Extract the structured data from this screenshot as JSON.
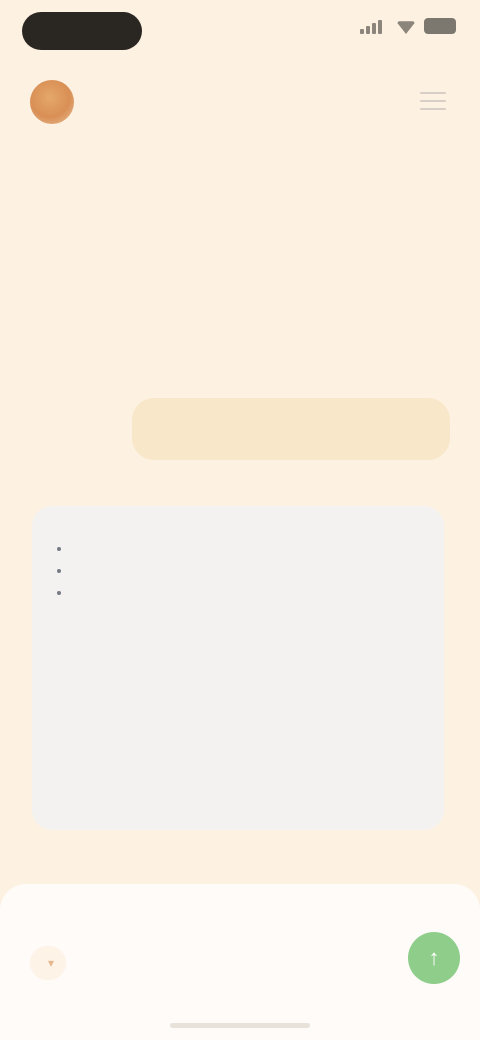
{
  "status_bar": {
    "time": "",
    "pill_color": "#2a2622"
  },
  "header": {
    "name": "",
    "subtitle": ""
  },
  "chat": {
    "user_message": "",
    "assistant_paragraph_1": "",
    "assistant_paragraph_2": "",
    "assistant_list": [
      "",
      "",
      ""
    ],
    "assistant_paragraph_3": ""
  },
  "composer": {
    "placeholder": "",
    "model_label": "",
    "send_color": "#8fcd8a"
  },
  "icons": {
    "avatar": "avatar-image",
    "menu": "menu-icon",
    "send": "send-arrow-icon",
    "chevron": "chevron-down-icon"
  },
  "colors": {
    "background": "#fdf1e1",
    "user_bubble": "#f8e7c8",
    "assistant_card": "#f4f2f1",
    "accent": "#e0a772"
  }
}
